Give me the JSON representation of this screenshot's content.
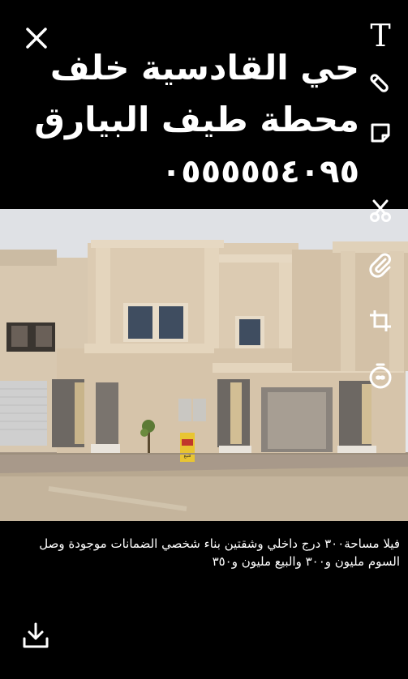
{
  "caption": {
    "line1": "حي القادسية خلف",
    "line2": "محطة طيف البيارق",
    "phone": "٠٥٥٥٥٥٤٠٩٥"
  },
  "description": "فيلا مساحة٣٠٠ درج داخلي وشقتين بناء شخصي الضمانات موجودة وصل السوم مليون و٣٠٠ والبيع مليون و٣٥٠",
  "toolbar": {
    "text_tool_label": "T",
    "icons": [
      "text-icon",
      "pencil-icon",
      "sticker-icon",
      "scissors-icon",
      "paperclip-icon",
      "crop-icon",
      "timer-icon"
    ]
  },
  "photo": {
    "sign_text": "للبيع"
  },
  "icons": {
    "close": "close-icon",
    "download": "download-icon"
  },
  "colors": {
    "background": "#000000",
    "text": "#ffffff"
  }
}
